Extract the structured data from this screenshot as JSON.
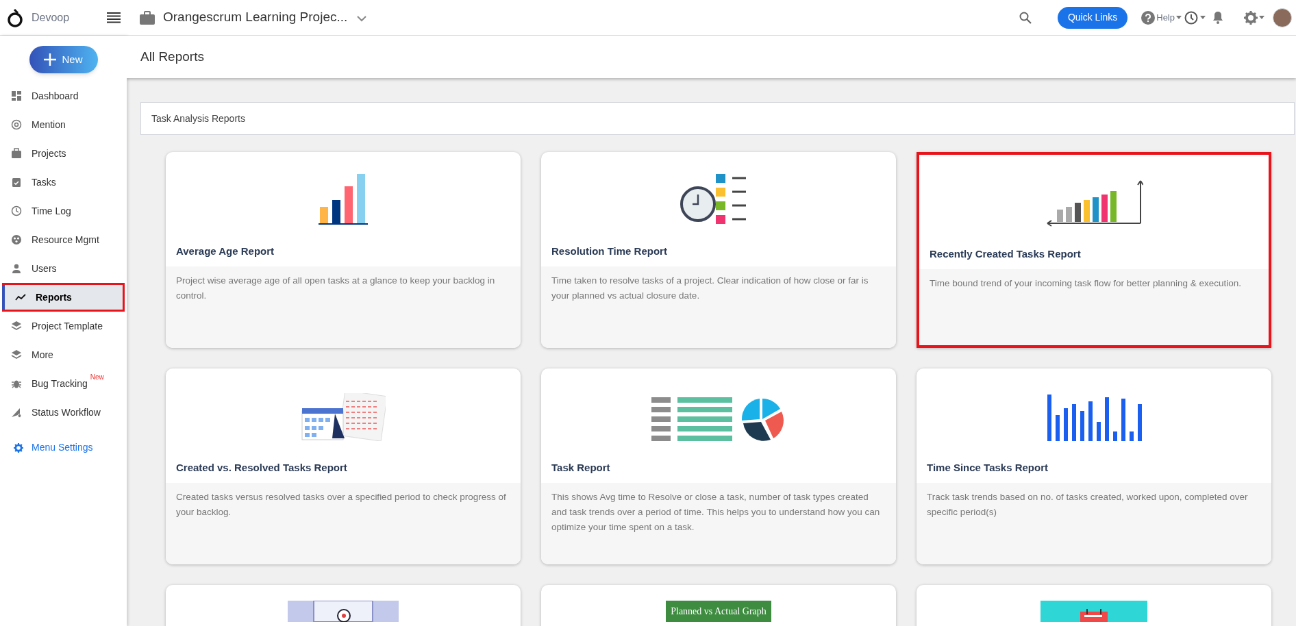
{
  "brand": {
    "name": "Devoop"
  },
  "project": {
    "name": "Orangescrum Learning Projec..."
  },
  "topbar": {
    "quick_links": "Quick Links",
    "help": "Help"
  },
  "new_button": "New",
  "sidebar": {
    "items": [
      {
        "label": "Dashboard",
        "selected": false,
        "highlighted": false
      },
      {
        "label": "Mention",
        "selected": false,
        "highlighted": false
      },
      {
        "label": "Projects",
        "selected": false,
        "highlighted": false
      },
      {
        "label": "Tasks",
        "selected": false,
        "highlighted": false
      },
      {
        "label": "Time Log",
        "selected": false,
        "highlighted": false
      },
      {
        "label": "Resource Mgmt",
        "selected": false,
        "highlighted": false
      },
      {
        "label": "Users",
        "selected": false,
        "highlighted": false
      },
      {
        "label": "Reports",
        "selected": true,
        "highlighted": true
      },
      {
        "label": "Project Template",
        "selected": false,
        "highlighted": false
      },
      {
        "label": "More",
        "selected": false,
        "highlighted": false
      },
      {
        "label": "Bug Tracking",
        "selected": false,
        "highlighted": false,
        "badge": "New"
      },
      {
        "label": "Status Workflow",
        "selected": false,
        "highlighted": false
      }
    ],
    "menu_settings": "Menu Settings"
  },
  "page_title": "All Reports",
  "section": {
    "title": "Task Analysis Reports"
  },
  "cards": [
    {
      "title": "Average Age Report",
      "description": "Project wise average age of all open tasks at a glance to keep your backlog in control.",
      "highlighted": false
    },
    {
      "title": "Resolution Time Report",
      "description": "Time taken to resolve tasks of a project. Clear indication of how close or far is your planned vs actual closure date.",
      "highlighted": false
    },
    {
      "title": "Recently Created Tasks Report",
      "description": "Time bound trend of your incoming task flow for better planning & execution.",
      "highlighted": true
    },
    {
      "title": "Created vs. Resolved Tasks Report",
      "description": "Created tasks versus resolved tasks over a specified period to check progress of your backlog.",
      "highlighted": false
    },
    {
      "title": "Task Report",
      "description": "This shows Avg time to Resolve or close a task, number of task types created and task trends over a period of time. This helps you to understand how you can optimize your time spent on a task.",
      "highlighted": false
    },
    {
      "title": "Time Since Tasks Report",
      "description": "Track task trends based on no. of tasks created, worked upon, completed over specific period(s)",
      "highlighted": false
    },
    {
      "highlighted": false
    },
    {
      "caption": "Planned vs Actual Graph",
      "highlighted": false
    },
    {
      "highlighted": false
    }
  ]
}
